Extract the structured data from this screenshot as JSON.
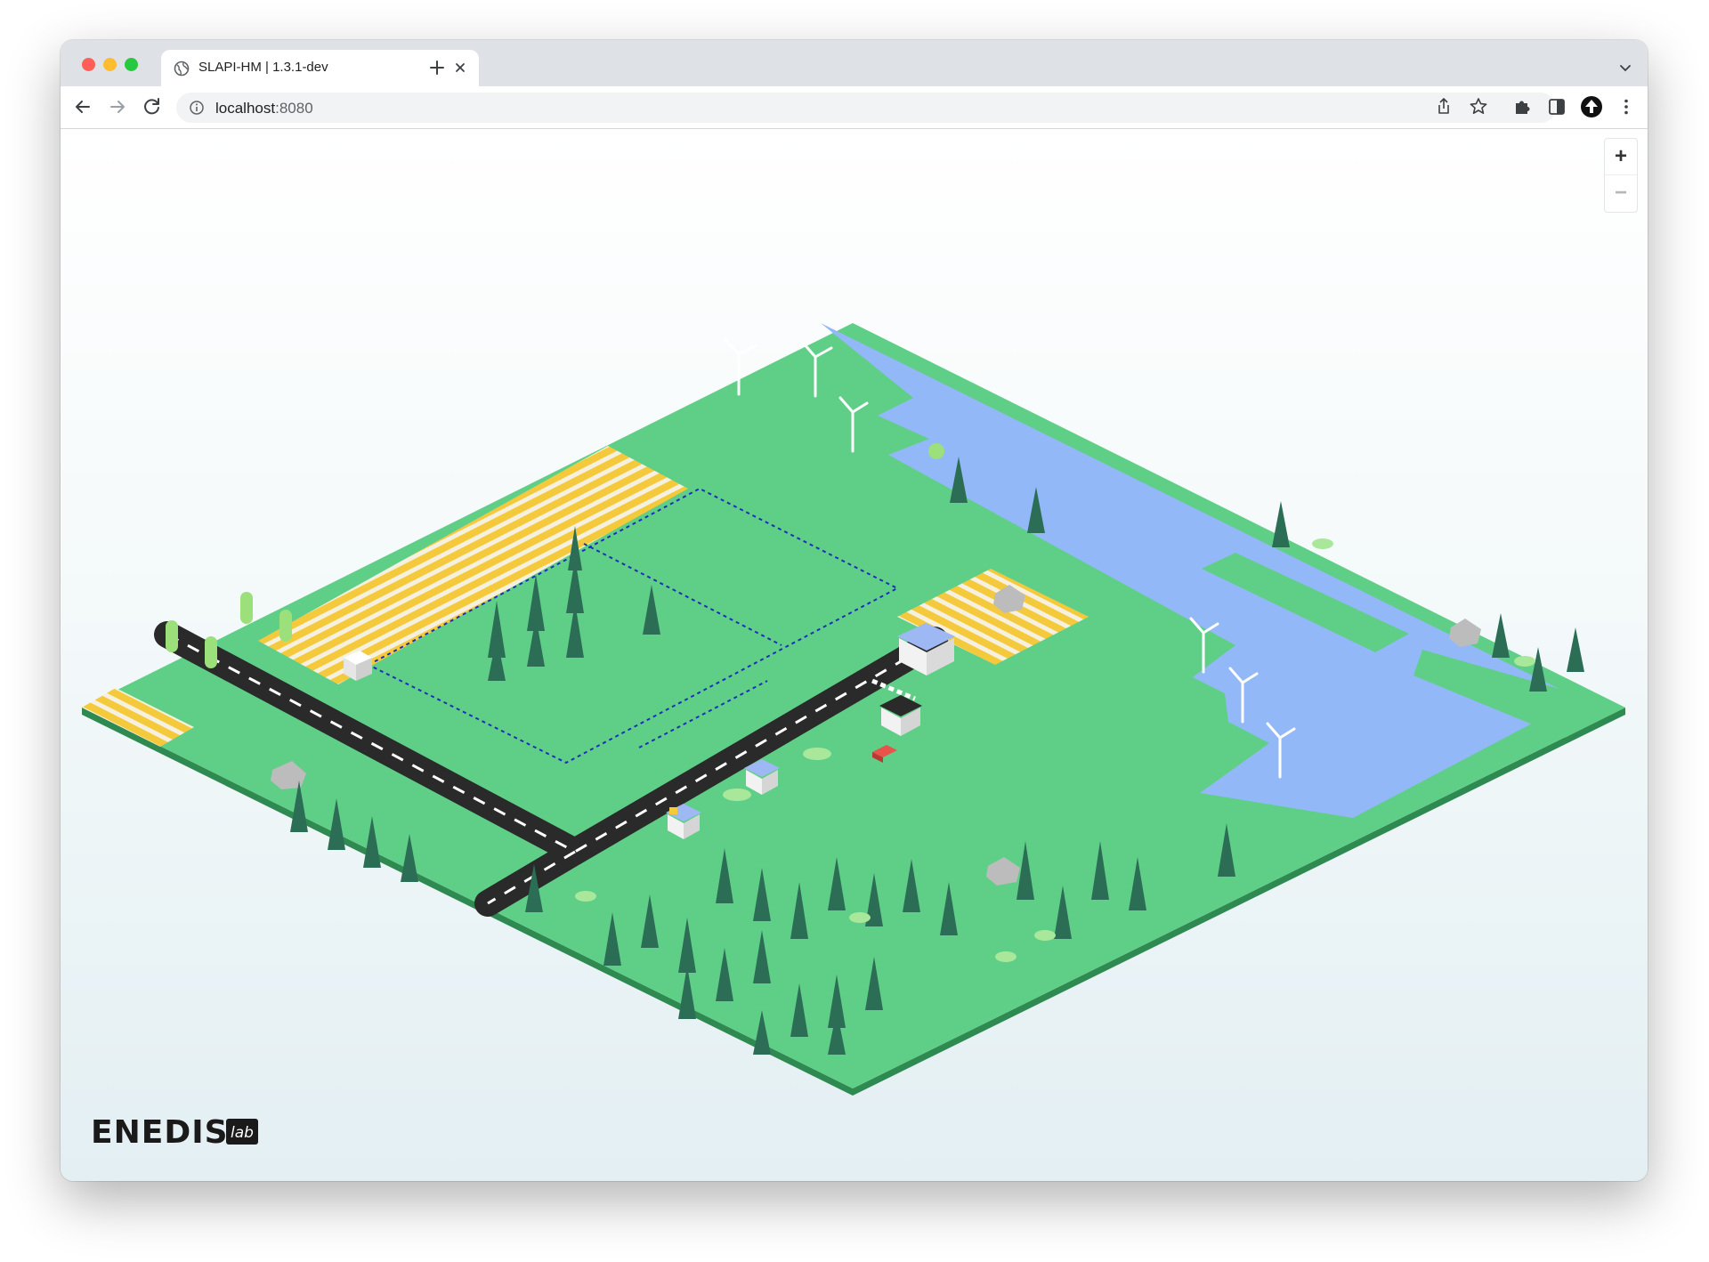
{
  "browser": {
    "tab_title": "SLAPI-HM | 1.3.1-dev",
    "url_host": "localhost",
    "url_port": ":8080"
  },
  "map": {
    "zoom_in_label": "+",
    "zoom_out_label": "−",
    "terrain_color": "#5fcf88",
    "water_color": "#93b8f7",
    "road_color": "#2a2a2a",
    "field_color": "#f5c93c"
  },
  "logo": {
    "wordmark": "ENEDIS",
    "badge": "lab"
  }
}
